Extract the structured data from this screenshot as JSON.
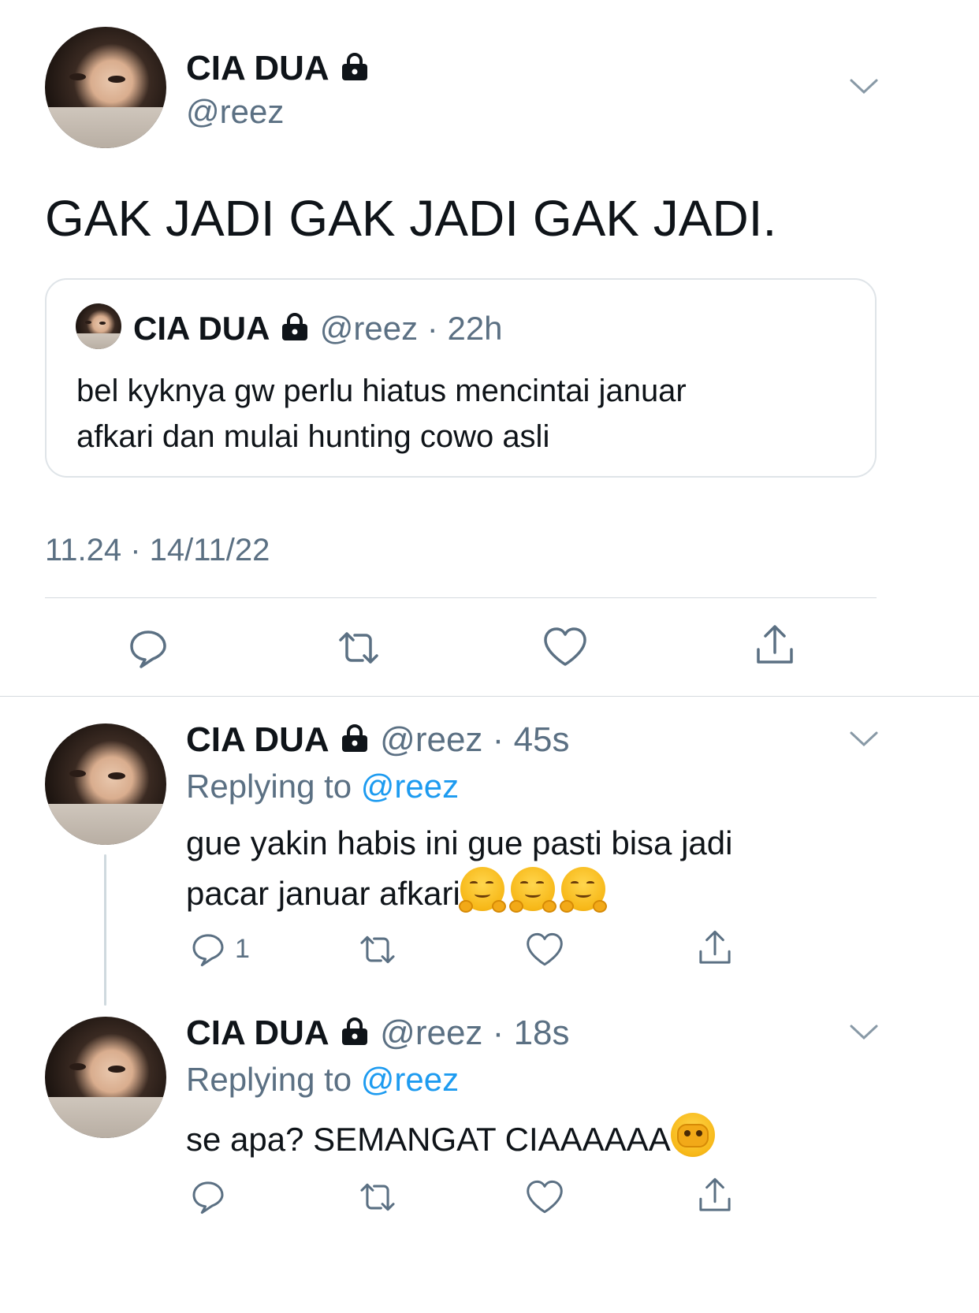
{
  "main_tweet": {
    "name": "CIA DUA",
    "handle": "@reez",
    "text": "GAK JADI GAK JADI GAK JADI.",
    "quoted": {
      "name": "CIA DUA",
      "handle": "@reez",
      "sep": "·",
      "time": "22h",
      "text_line1": "bel kyknya gw perlu hiatus mencintai januar",
      "text_line2": "afkari dan mulai hunting cowo asli"
    },
    "timestamp": "11.24 · 14/11/22"
  },
  "replies": [
    {
      "name": "CIA DUA",
      "handle": "@reez",
      "sep": "·",
      "time": "45s",
      "replying_prefix": "Replying to",
      "replying_to": "@reez",
      "text_line1": "gue yakin habis ini gue pasti bisa jadi",
      "text_line2": "pacar januar afkari",
      "reply_count": "1"
    },
    {
      "name": "CIA DUA",
      "handle": "@reez",
      "sep": "·",
      "time": "18s",
      "replying_prefix": "Replying to",
      "replying_to": "@reez",
      "text_line1": "se apa? SEMANGAT CIAAAAAA"
    }
  ],
  "icons": {
    "lock": "lock-icon",
    "chevron": "chevron-down-icon",
    "reply": "reply-icon",
    "retweet": "retweet-icon",
    "like": "heart-icon",
    "share": "share-icon",
    "emoji_hug": "hugging-face-emoji",
    "emoji_peek": "face-with-peeking-eye-emoji"
  },
  "colors": {
    "text": "#0f1419",
    "secondary": "#5b7083",
    "link": "#1d9bf0",
    "divider": "#d5dadf"
  }
}
